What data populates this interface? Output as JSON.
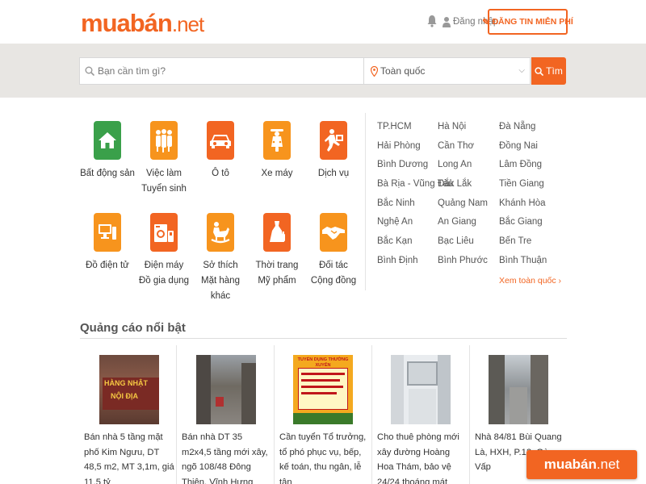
{
  "header": {
    "logo_main": "muabán",
    "logo_suffix": ".net",
    "login_label": "Đăng nhập",
    "post_button": "ĐĂNG TIN MIỄN PHÍ"
  },
  "search": {
    "placeholder": "Bạn cần tìm gì?",
    "location": "Toàn quốc",
    "button_label": "Tìm"
  },
  "categories": [
    {
      "line1": "Bất động sản",
      "line2": "",
      "icon": "house-icon",
      "color": "#3aa04a"
    },
    {
      "line1": "Việc làm",
      "line2": "Tuyển sinh",
      "icon": "people-icon",
      "color": "#f7941d"
    },
    {
      "line1": "Ô tô",
      "line2": "",
      "icon": "car-icon",
      "color": "#f26522"
    },
    {
      "line1": "Xe máy",
      "line2": "",
      "icon": "scooter-icon",
      "color": "#f7941d"
    },
    {
      "line1": "Dịch vụ",
      "line2": "",
      "icon": "delivery-man-icon",
      "color": "#f26522"
    },
    {
      "line1": "Đồ điện tử",
      "line2": "",
      "icon": "computer-icon",
      "color": "#f7941d"
    },
    {
      "line1": "Điện máy",
      "line2": "Đồ gia dụng",
      "icon": "washing-machine-icon",
      "color": "#f26522"
    },
    {
      "line1": "Sở thích",
      "line2": "Mặt hàng khác",
      "icon": "rocking-horse-icon",
      "color": "#f7941d"
    },
    {
      "line1": "Thời trang",
      "line2": "Mỹ phẩm",
      "icon": "dress-icon",
      "color": "#f26522"
    },
    {
      "line1": "Đối tác",
      "line2": "Cộng đồng",
      "icon": "handshake-icon",
      "color": "#f7941d"
    }
  ],
  "cities": [
    [
      "TP.HCM",
      "Hải Phòng",
      "Bình Dương",
      "Bà Rịa - Vũng Tàu",
      "Bắc Ninh",
      "Nghệ An",
      "Bắc Kạn",
      "Bình Định"
    ],
    [
      "Hà Nội",
      "Cần Thơ",
      "Long An",
      "Đắk Lắk",
      "Quảng Nam",
      "An Giang",
      "Bạc Liêu",
      "Bình Phước"
    ],
    [
      "Đà Nẵng",
      "Đồng Nai",
      "Lâm Đồng",
      "Tiền Giang",
      "Khánh Hòa",
      "Bắc Giang",
      "Bến Tre",
      "Bình Thuận"
    ]
  ],
  "see_all": "Xem toàn quốc ›",
  "featured": {
    "title": "Quảng cáo nổi bật",
    "items": [
      {
        "text": "Bán nhà 5 tầng mặt phố Kim Ngưu, DT 48,5 m2, MT 3,1m, giá 11,5 tỷ",
        "sign_line1": "HÀNG NHẬT",
        "sign_line2": "NỘI ĐỊA"
      },
      {
        "text": "Bán nhà DT 35 m2x4,5 tầng mới xây, ngõ 108/48 Đông Thiên, Vĩnh Hưng"
      },
      {
        "text": "Cần tuyển Tổ trưởng, tổ phó phục vụ, bếp, kế toán, thu ngân, lễ tân",
        "poster_title": "TUYỂN DỤNG THƯỜNG XUYÊN"
      },
      {
        "text": "Cho thuê phòng mới xây đường Hoàng Hoa Thám, bảo vệ 24/24 thoáng mát"
      },
      {
        "text": "Nhà 84/81 Bùi Quang Là, HXH, P.12, Gò Vấp"
      }
    ]
  },
  "badge": {
    "main": "muabán",
    "suffix": ".net"
  },
  "colors": {
    "brand": "#f26522",
    "accent_orange": "#f7941d",
    "green": "#3aa04a",
    "band": "#e8e6e3"
  }
}
